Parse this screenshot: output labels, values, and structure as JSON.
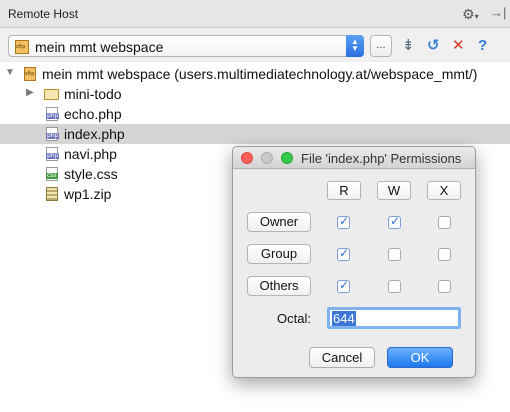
{
  "panel": {
    "title": "Remote Host",
    "gear_icon": "gear-icon",
    "hide_icon": "hide-panel-icon"
  },
  "toolbar": {
    "server_name": "mein mmt webspace",
    "more_label": "...",
    "icons": [
      "collapse-all-icon",
      "sync-icon",
      "delete-icon",
      "help-icon"
    ],
    "colors": {
      "accent": "#2a6fe0",
      "delete": "#d9342b"
    }
  },
  "tree": {
    "root": "mein mmt webspace (users.multimediatechnology.at/webspace_mmt/)",
    "items": [
      {
        "label": "mini-todo",
        "type": "folder"
      },
      {
        "label": "echo.php",
        "type": "php"
      },
      {
        "label": "index.php",
        "type": "php",
        "selected": true
      },
      {
        "label": "navi.php",
        "type": "php"
      },
      {
        "label": "style.css",
        "type": "css"
      },
      {
        "label": "wp1.zip",
        "type": "zip"
      }
    ]
  },
  "dialog": {
    "title": "File 'index.php' Permissions",
    "columns": [
      "R",
      "W",
      "X"
    ],
    "rows": [
      {
        "label": "Owner",
        "r": true,
        "w": true,
        "x": false
      },
      {
        "label": "Group",
        "r": true,
        "w": false,
        "x": false
      },
      {
        "label": "Others",
        "r": true,
        "w": false,
        "x": false
      }
    ],
    "octal_label": "Octal:",
    "octal_value": "644",
    "cancel_label": "Cancel",
    "ok_label": "OK"
  }
}
